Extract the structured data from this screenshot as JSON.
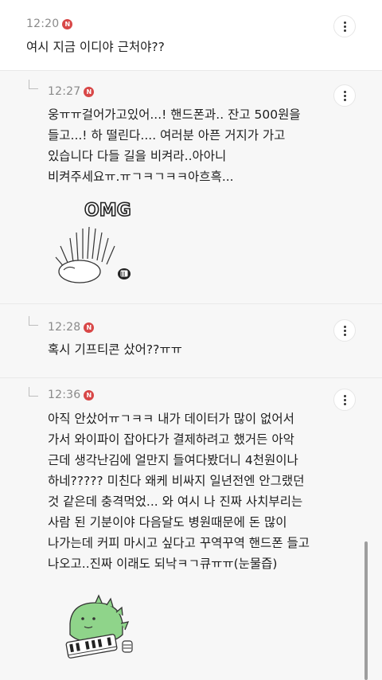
{
  "comments": [
    {
      "time": "12:20",
      "badge": "N",
      "text": "여시 지금 이디야 근처야??"
    },
    {
      "time": "12:27",
      "badge": "N",
      "text": "웅ㅠㅠ걸어가고있어...! 핸드폰과.. 잔고 500원을\n들고...! 하 떨린다.... 여러분 아픈 거지가 가고\n있습니다 다들 길을 비켜라..아아니\n비켜주세요ㅠ.ㅠㄱㅋㄱㅋㅋ아흐흑...",
      "sticker_text": "OMG",
      "sticker_icon": "hedgehog-sticker"
    },
    {
      "time": "12:28",
      "badge": "N",
      "text": "혹시 기프티콘 샀어??ㅠㅠ"
    },
    {
      "time": "12:36",
      "badge": "N",
      "text": "아직 안샀어ㅠㄱㅋㅋ 내가 데이터가 많이 없어서\n가서 와이파이 잡아다가 결제하려고 했거든 아악\n근데 생각난김에 얼만지 들여다봤더니 4천원이나\n하네????? 미친다 왜케 비싸지 일년전엔 안그랬던\n것 같은데 충격먹었... 와 여시 나 진짜 사치부리는\n사람 된 기분이야 다음달도 병원때문에 돈 많이\n나가는데 커피 마시고 싶다고 꾸역꾸역 핸드폰 들고\n나오고..진짜 이래도 되낙ㅋㄱ큐ㅠㅠ(눈물즙)",
      "sticker_icon": "dinosaur-piano-sticker"
    }
  ],
  "colors": {
    "badge": "#d84747",
    "reply_bg": "#f7f7f7",
    "dino_green": "#8fd48a"
  }
}
